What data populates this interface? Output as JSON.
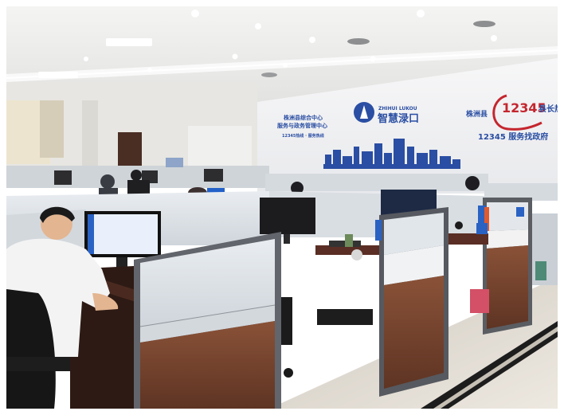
{
  "scene": {
    "wall_signs": {
      "left_block_line1": "株洲县综合中心",
      "left_block_line2": "服务与政务管理中心",
      "left_block_line3": "12345热线 · 服务热线",
      "logo_pinyin": "ZHIHUI LUKOU",
      "logo_title": "智慧渌口",
      "hotline_prefix": "株洲县",
      "hotline_number": "12345",
      "hotline_suffix": "县长热线",
      "hotline_slogan": "12345 服务找政府"
    },
    "colors": {
      "wall_text_blue": "#2a4ea3",
      "wall_accent_red": "#c4262e",
      "partition_wood": "#7a4630",
      "partition_panel": "#dfe4ea",
      "monitor_screen": "#e9f0fb"
    }
  }
}
